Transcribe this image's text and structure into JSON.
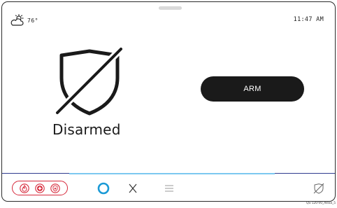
{
  "header": {
    "temperature": "76°",
    "time": "11:47 AM",
    "weather_icon": "partly-cloudy-icon"
  },
  "status": {
    "text": "Disarmed",
    "icon": "shield-disarmed-icon"
  },
  "actions": {
    "arm_label": "ARM"
  },
  "bottom_bar": {
    "emergency_icons": [
      "fire-icon",
      "medical-icon",
      "police-icon"
    ],
    "nav_icons": [
      "alexa-ring-icon",
      "x-icon",
      "menu-icon",
      "shield-disarmed-small-icon"
    ]
  },
  "footer": {
    "code": "QS-120-V0_Alexa_5"
  },
  "colors": {
    "emergency_red": "#d6283a",
    "alexa_blue": "#1b9ad6",
    "divider_blue": "#2f3a8f",
    "divider_glow": "#7cc8f0",
    "button_dark": "#1a1a1a"
  }
}
